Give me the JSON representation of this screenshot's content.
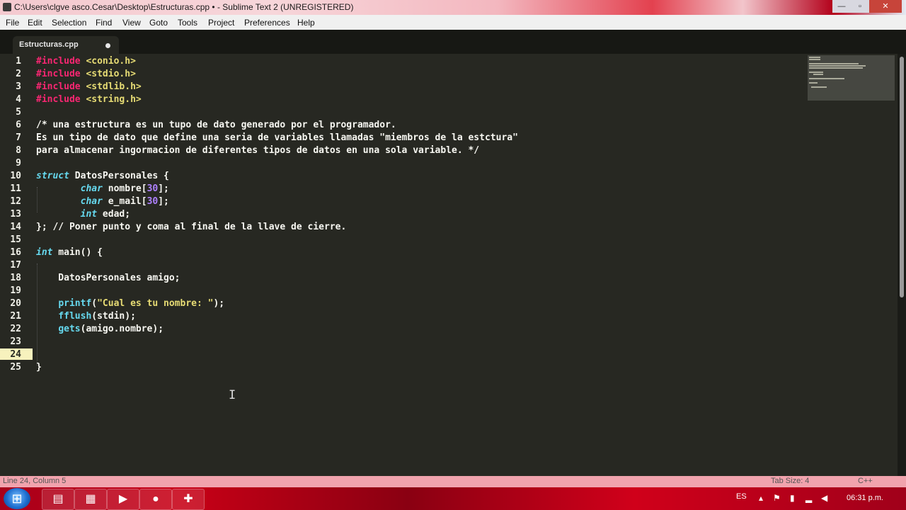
{
  "window": {
    "title": "C:\\Users\\clgve asco.Cesar\\Desktop\\Estructuras.cpp • - Sublime Text 2 (UNREGISTERED)",
    "min_glyph": "—",
    "max_glyph": "▫",
    "close_glyph": "✕"
  },
  "menu": [
    "File",
    "Edit",
    "Selection",
    "Find",
    "View",
    "Goto",
    "Tools",
    "Project",
    "Preferences",
    "Help"
  ],
  "tab": {
    "label": "Estructuras.cpp",
    "modified": true
  },
  "editor": {
    "current_line": 24,
    "lines": [
      [
        {
          "t": "#include ",
          "c": "pp"
        },
        {
          "t": "<conio.h>",
          "c": "str"
        }
      ],
      [
        {
          "t": "#include ",
          "c": "pp"
        },
        {
          "t": "<stdio.h>",
          "c": "str"
        }
      ],
      [
        {
          "t": "#include ",
          "c": "pp"
        },
        {
          "t": "<stdlib.h>",
          "c": "str"
        }
      ],
      [
        {
          "t": "#include ",
          "c": "pp"
        },
        {
          "t": "<string.h>",
          "c": "str"
        }
      ],
      [],
      [
        {
          "t": "/* una estructura es un tupo de dato generado por el programador.",
          "c": ""
        }
      ],
      [
        {
          "t": "Es un tipo de dato que define una seria de variables llamadas \"miembros de la estctura\"",
          "c": ""
        }
      ],
      [
        {
          "t": "para almacenar ingormacion de diferentes tipos de datos en una sola variable. */",
          "c": ""
        }
      ],
      [],
      [
        {
          "t": "struct",
          "c": "kw"
        },
        {
          "t": " DatosPersonales {",
          "c": ""
        }
      ],
      [
        {
          "t": "        ",
          "c": ""
        },
        {
          "t": "char",
          "c": "kw"
        },
        {
          "t": " nombre[",
          "c": ""
        },
        {
          "t": "30",
          "c": "num"
        },
        {
          "t": "];",
          "c": ""
        }
      ],
      [
        {
          "t": "        ",
          "c": ""
        },
        {
          "t": "char",
          "c": "kw"
        },
        {
          "t": " e_mail[",
          "c": ""
        },
        {
          "t": "30",
          "c": "num"
        },
        {
          "t": "];",
          "c": ""
        }
      ],
      [
        {
          "t": "        ",
          "c": ""
        },
        {
          "t": "int",
          "c": "kw"
        },
        {
          "t": " edad;",
          "c": ""
        }
      ],
      [
        {
          "t": "}; // Poner punto y coma al final de la llave de cierre.",
          "c": ""
        }
      ],
      [],
      [
        {
          "t": "int",
          "c": "kw"
        },
        {
          "t": " main() {",
          "c": ""
        }
      ],
      [],
      [
        {
          "t": "    DatosPersonales amigo;",
          "c": ""
        }
      ],
      [],
      [
        {
          "t": "    ",
          "c": ""
        },
        {
          "t": "printf",
          "c": "fn"
        },
        {
          "t": "(",
          "c": ""
        },
        {
          "t": "\"Cual es tu nombre: \"",
          "c": "str"
        },
        {
          "t": ");",
          "c": ""
        }
      ],
      [
        {
          "t": "    ",
          "c": ""
        },
        {
          "t": "fflush",
          "c": "fn"
        },
        {
          "t": "(stdin);",
          "c": ""
        }
      ],
      [
        {
          "t": "    ",
          "c": ""
        },
        {
          "t": "gets",
          "c": "fn"
        },
        {
          "t": "(amigo.nombre);",
          "c": ""
        }
      ],
      [],
      [],
      [
        {
          "t": "}",
          "c": ""
        }
      ]
    ]
  },
  "status": {
    "left": "Line 24, Column 5",
    "tab_size": "Tab Size: 4",
    "syntax": "C++"
  },
  "taskbar": {
    "start_glyph": "⊞",
    "apps": [
      {
        "name": "sublime-text-app",
        "glyph": "▤"
      },
      {
        "name": "file-explorer-app",
        "glyph": "▦"
      },
      {
        "name": "media-player-app",
        "glyph": "▶"
      },
      {
        "name": "firefox-app",
        "glyph": "●"
      },
      {
        "name": "camtasia-app",
        "glyph": "✚"
      }
    ],
    "language": "ES",
    "clock": "06:31 p.m."
  }
}
